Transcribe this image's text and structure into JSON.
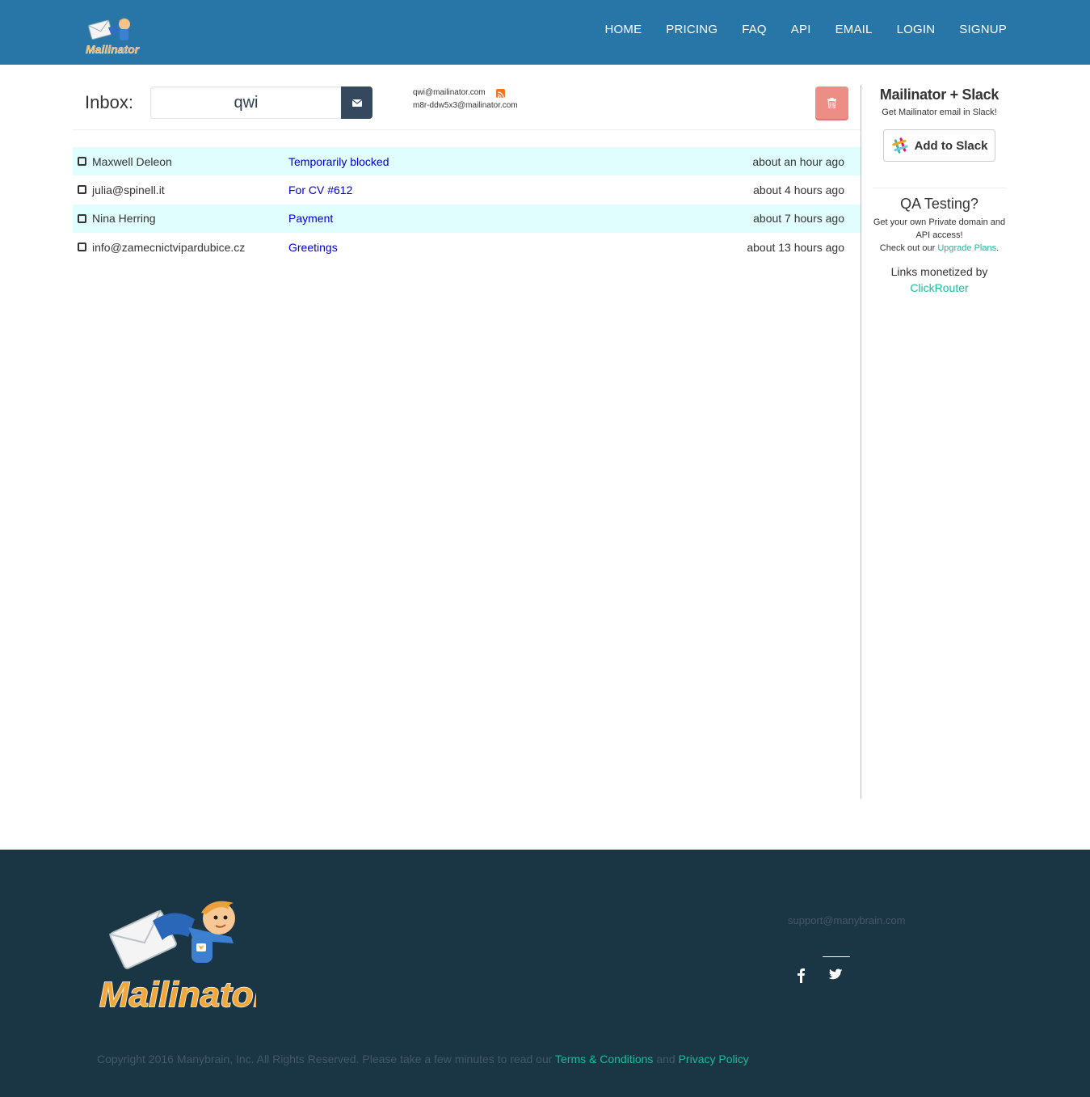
{
  "header": {
    "logo_text": "Mailinator",
    "nav": [
      "HOME",
      "PRICING",
      "FAQ",
      "API",
      "EMAIL",
      "LOGIN",
      "SIGNUP"
    ]
  },
  "inbox": {
    "label": "Inbox:",
    "value": "qwi",
    "address_primary": "qwi@mailinator.com",
    "address_alias": "m8r-ddw5x3@mailinator.com"
  },
  "messages": [
    {
      "from": "Maxwell Deleon",
      "subject": "Temporarily blocked",
      "time": "about an hour ago"
    },
    {
      "from": "julia@spinell.it",
      "subject": "For CV #612",
      "time": "about 4 hours ago"
    },
    {
      "from": "Nina Herring",
      "subject": "Payment",
      "time": "about 7 hours ago"
    },
    {
      "from": "info@zamecnictvipardubice.cz",
      "subject": "Greetings",
      "time": "about 13 hours ago"
    }
  ],
  "sidebar": {
    "slack_title": "Mailinator + Slack",
    "slack_sub": "Get Mailinator email in Slack!",
    "slack_button": "Add to Slack",
    "qa_title": "QA Testing?",
    "qa_line1": "Get your own Private domain and API access!",
    "qa_line2_prefix": "Check out our ",
    "qa_link": "Upgrade Plans",
    "qa_line2_suffix": ".",
    "monetized_prefix": "Links monetized by",
    "monetized_link": "ClickRouter"
  },
  "footer": {
    "support_email": "support@manybrain.com",
    "copyright": "Copyright 2016 Manybrain, Inc. All Rights Reserved. Please take a few minutes to read our ",
    "terms_link": "Terms & Conditions",
    "and_text": " and ",
    "privacy_link": "Privacy Policy"
  },
  "colors": {
    "header_bg": "#2876a8",
    "footer_bg": "#1a3543",
    "row_alt_bg": "#e0fefe",
    "link_blue": "#0000cc",
    "teal": "#1abc9c",
    "delete_btn": "#ec8e86",
    "go_btn": "#34495e"
  },
  "icons": [
    "envelope-icon",
    "rss-icon",
    "trash-icon",
    "slack-icon",
    "facebook-icon",
    "twitter-icon"
  ]
}
